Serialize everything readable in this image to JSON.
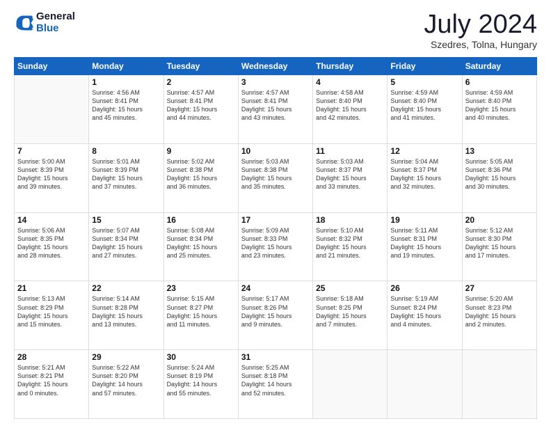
{
  "logo": {
    "line1": "General",
    "line2": "Blue"
  },
  "title": "July 2024",
  "subtitle": "Szedres, Tolna, Hungary",
  "weekdays": [
    "Sunday",
    "Monday",
    "Tuesday",
    "Wednesday",
    "Thursday",
    "Friday",
    "Saturday"
  ],
  "weeks": [
    [
      {
        "day": "",
        "sunrise": "",
        "sunset": "",
        "daylight": ""
      },
      {
        "day": "1",
        "sunrise": "4:56 AM",
        "sunset": "8:41 PM",
        "daylight": "15 hours and 45 minutes."
      },
      {
        "day": "2",
        "sunrise": "4:57 AM",
        "sunset": "8:41 PM",
        "daylight": "15 hours and 44 minutes."
      },
      {
        "day": "3",
        "sunrise": "4:57 AM",
        "sunset": "8:41 PM",
        "daylight": "15 hours and 43 minutes."
      },
      {
        "day": "4",
        "sunrise": "4:58 AM",
        "sunset": "8:40 PM",
        "daylight": "15 hours and 42 minutes."
      },
      {
        "day": "5",
        "sunrise": "4:59 AM",
        "sunset": "8:40 PM",
        "daylight": "15 hours and 41 minutes."
      },
      {
        "day": "6",
        "sunrise": "4:59 AM",
        "sunset": "8:40 PM",
        "daylight": "15 hours and 40 minutes."
      }
    ],
    [
      {
        "day": "7",
        "sunrise": "5:00 AM",
        "sunset": "8:39 PM",
        "daylight": "15 hours and 39 minutes."
      },
      {
        "day": "8",
        "sunrise": "5:01 AM",
        "sunset": "8:39 PM",
        "daylight": "15 hours and 37 minutes."
      },
      {
        "day": "9",
        "sunrise": "5:02 AM",
        "sunset": "8:38 PM",
        "daylight": "15 hours and 36 minutes."
      },
      {
        "day": "10",
        "sunrise": "5:03 AM",
        "sunset": "8:38 PM",
        "daylight": "15 hours and 35 minutes."
      },
      {
        "day": "11",
        "sunrise": "5:03 AM",
        "sunset": "8:37 PM",
        "daylight": "15 hours and 33 minutes."
      },
      {
        "day": "12",
        "sunrise": "5:04 AM",
        "sunset": "8:37 PM",
        "daylight": "15 hours and 32 minutes."
      },
      {
        "day": "13",
        "sunrise": "5:05 AM",
        "sunset": "8:36 PM",
        "daylight": "15 hours and 30 minutes."
      }
    ],
    [
      {
        "day": "14",
        "sunrise": "5:06 AM",
        "sunset": "8:35 PM",
        "daylight": "15 hours and 28 minutes."
      },
      {
        "day": "15",
        "sunrise": "5:07 AM",
        "sunset": "8:34 PM",
        "daylight": "15 hours and 27 minutes."
      },
      {
        "day": "16",
        "sunrise": "5:08 AM",
        "sunset": "8:34 PM",
        "daylight": "15 hours and 25 minutes."
      },
      {
        "day": "17",
        "sunrise": "5:09 AM",
        "sunset": "8:33 PM",
        "daylight": "15 hours and 23 minutes."
      },
      {
        "day": "18",
        "sunrise": "5:10 AM",
        "sunset": "8:32 PM",
        "daylight": "15 hours and 21 minutes."
      },
      {
        "day": "19",
        "sunrise": "5:11 AM",
        "sunset": "8:31 PM",
        "daylight": "15 hours and 19 minutes."
      },
      {
        "day": "20",
        "sunrise": "5:12 AM",
        "sunset": "8:30 PM",
        "daylight": "15 hours and 17 minutes."
      }
    ],
    [
      {
        "day": "21",
        "sunrise": "5:13 AM",
        "sunset": "8:29 PM",
        "daylight": "15 hours and 15 minutes."
      },
      {
        "day": "22",
        "sunrise": "5:14 AM",
        "sunset": "8:28 PM",
        "daylight": "15 hours and 13 minutes."
      },
      {
        "day": "23",
        "sunrise": "5:15 AM",
        "sunset": "8:27 PM",
        "daylight": "15 hours and 11 minutes."
      },
      {
        "day": "24",
        "sunrise": "5:17 AM",
        "sunset": "8:26 PM",
        "daylight": "15 hours and 9 minutes."
      },
      {
        "day": "25",
        "sunrise": "5:18 AM",
        "sunset": "8:25 PM",
        "daylight": "15 hours and 7 minutes."
      },
      {
        "day": "26",
        "sunrise": "5:19 AM",
        "sunset": "8:24 PM",
        "daylight": "15 hours and 4 minutes."
      },
      {
        "day": "27",
        "sunrise": "5:20 AM",
        "sunset": "8:23 PM",
        "daylight": "15 hours and 2 minutes."
      }
    ],
    [
      {
        "day": "28",
        "sunrise": "5:21 AM",
        "sunset": "8:21 PM",
        "daylight": "15 hours and 0 minutes."
      },
      {
        "day": "29",
        "sunrise": "5:22 AM",
        "sunset": "8:20 PM",
        "daylight": "14 hours and 57 minutes."
      },
      {
        "day": "30",
        "sunrise": "5:24 AM",
        "sunset": "8:19 PM",
        "daylight": "14 hours and 55 minutes."
      },
      {
        "day": "31",
        "sunrise": "5:25 AM",
        "sunset": "8:18 PM",
        "daylight": "14 hours and 52 minutes."
      },
      {
        "day": "",
        "sunrise": "",
        "sunset": "",
        "daylight": ""
      },
      {
        "day": "",
        "sunrise": "",
        "sunset": "",
        "daylight": ""
      },
      {
        "day": "",
        "sunrise": "",
        "sunset": "",
        "daylight": ""
      }
    ]
  ]
}
